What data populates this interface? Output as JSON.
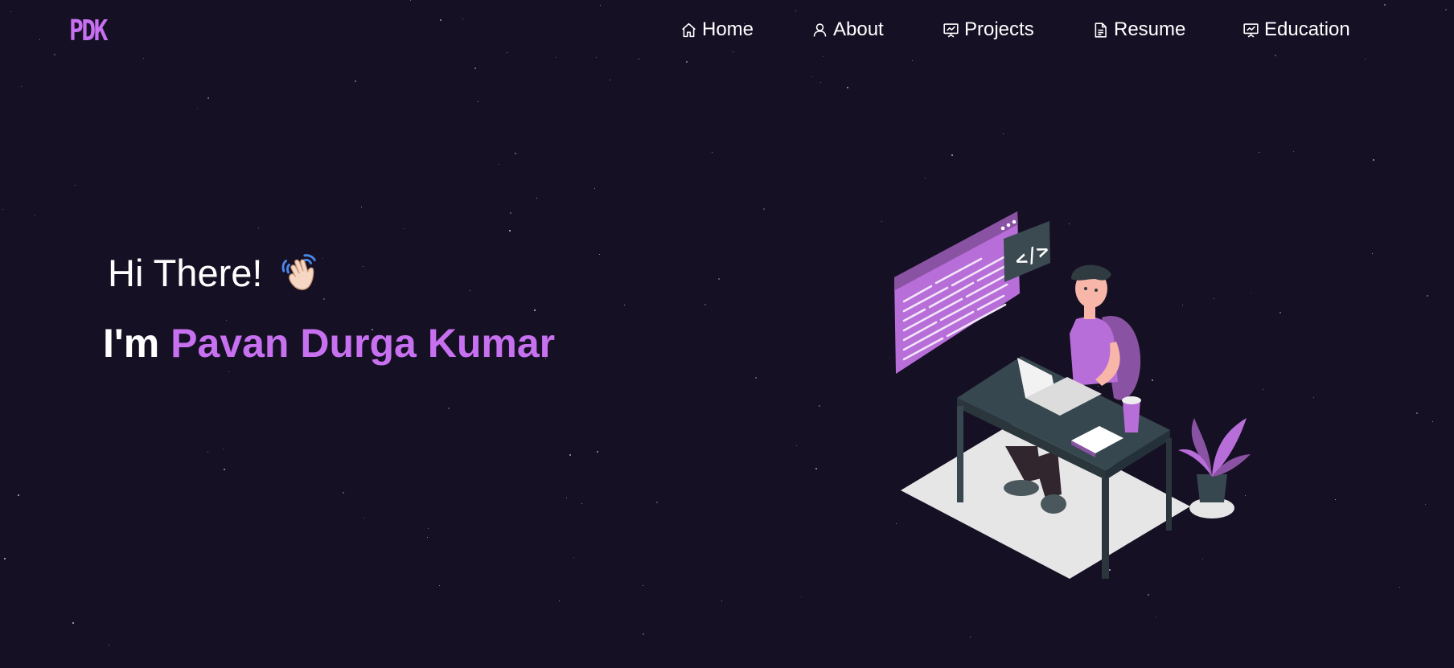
{
  "navbar": {
    "logo": "PDK",
    "items": [
      {
        "label": "Home",
        "icon": "home-icon"
      },
      {
        "label": "About",
        "icon": "user-icon"
      },
      {
        "label": "Projects",
        "icon": "presentation-icon"
      },
      {
        "label": "Resume",
        "icon": "document-icon"
      },
      {
        "label": "Education",
        "icon": "presentation-icon"
      }
    ]
  },
  "hero": {
    "greeting": "Hi There!",
    "greeting_emoji": "waving-hand",
    "intro_prefix": "I'm",
    "name": "Pavan Durga Kumar"
  },
  "colors": {
    "background": "#161024",
    "accent": "#c770f0",
    "text": "#ffffff"
  },
  "illustration": "developer-at-desk-illustration"
}
